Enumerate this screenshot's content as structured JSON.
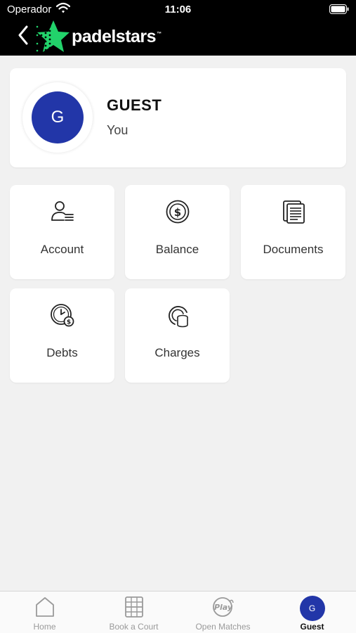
{
  "status_bar": {
    "carrier": "Operador",
    "time": "11:06"
  },
  "header": {
    "brand": "padelstars",
    "brand_mark": "™"
  },
  "profile": {
    "initial": "G",
    "name": "GUEST",
    "subtitle": "You"
  },
  "tiles": [
    {
      "label": "Account",
      "icon": "account-icon"
    },
    {
      "label": "Balance",
      "icon": "balance-icon"
    },
    {
      "label": "Documents",
      "icon": "documents-icon"
    },
    {
      "label": "Debts",
      "icon": "debts-icon"
    },
    {
      "label": "Charges",
      "icon": "charges-icon"
    }
  ],
  "tabbar": {
    "items": [
      {
        "label": "Home",
        "icon": "home-icon"
      },
      {
        "label": "Book a Court",
        "icon": "court-icon"
      },
      {
        "label": "Open Matches",
        "icon": "play-icon",
        "icon_text": "Play"
      },
      {
        "label": "Guest",
        "icon": "avatar",
        "initial": "G",
        "active": true
      }
    ]
  },
  "colors": {
    "accent_blue": "#2236a8",
    "brand_green": "#22d36b",
    "header_bg": "#000000",
    "page_bg": "#f1f1f1"
  }
}
